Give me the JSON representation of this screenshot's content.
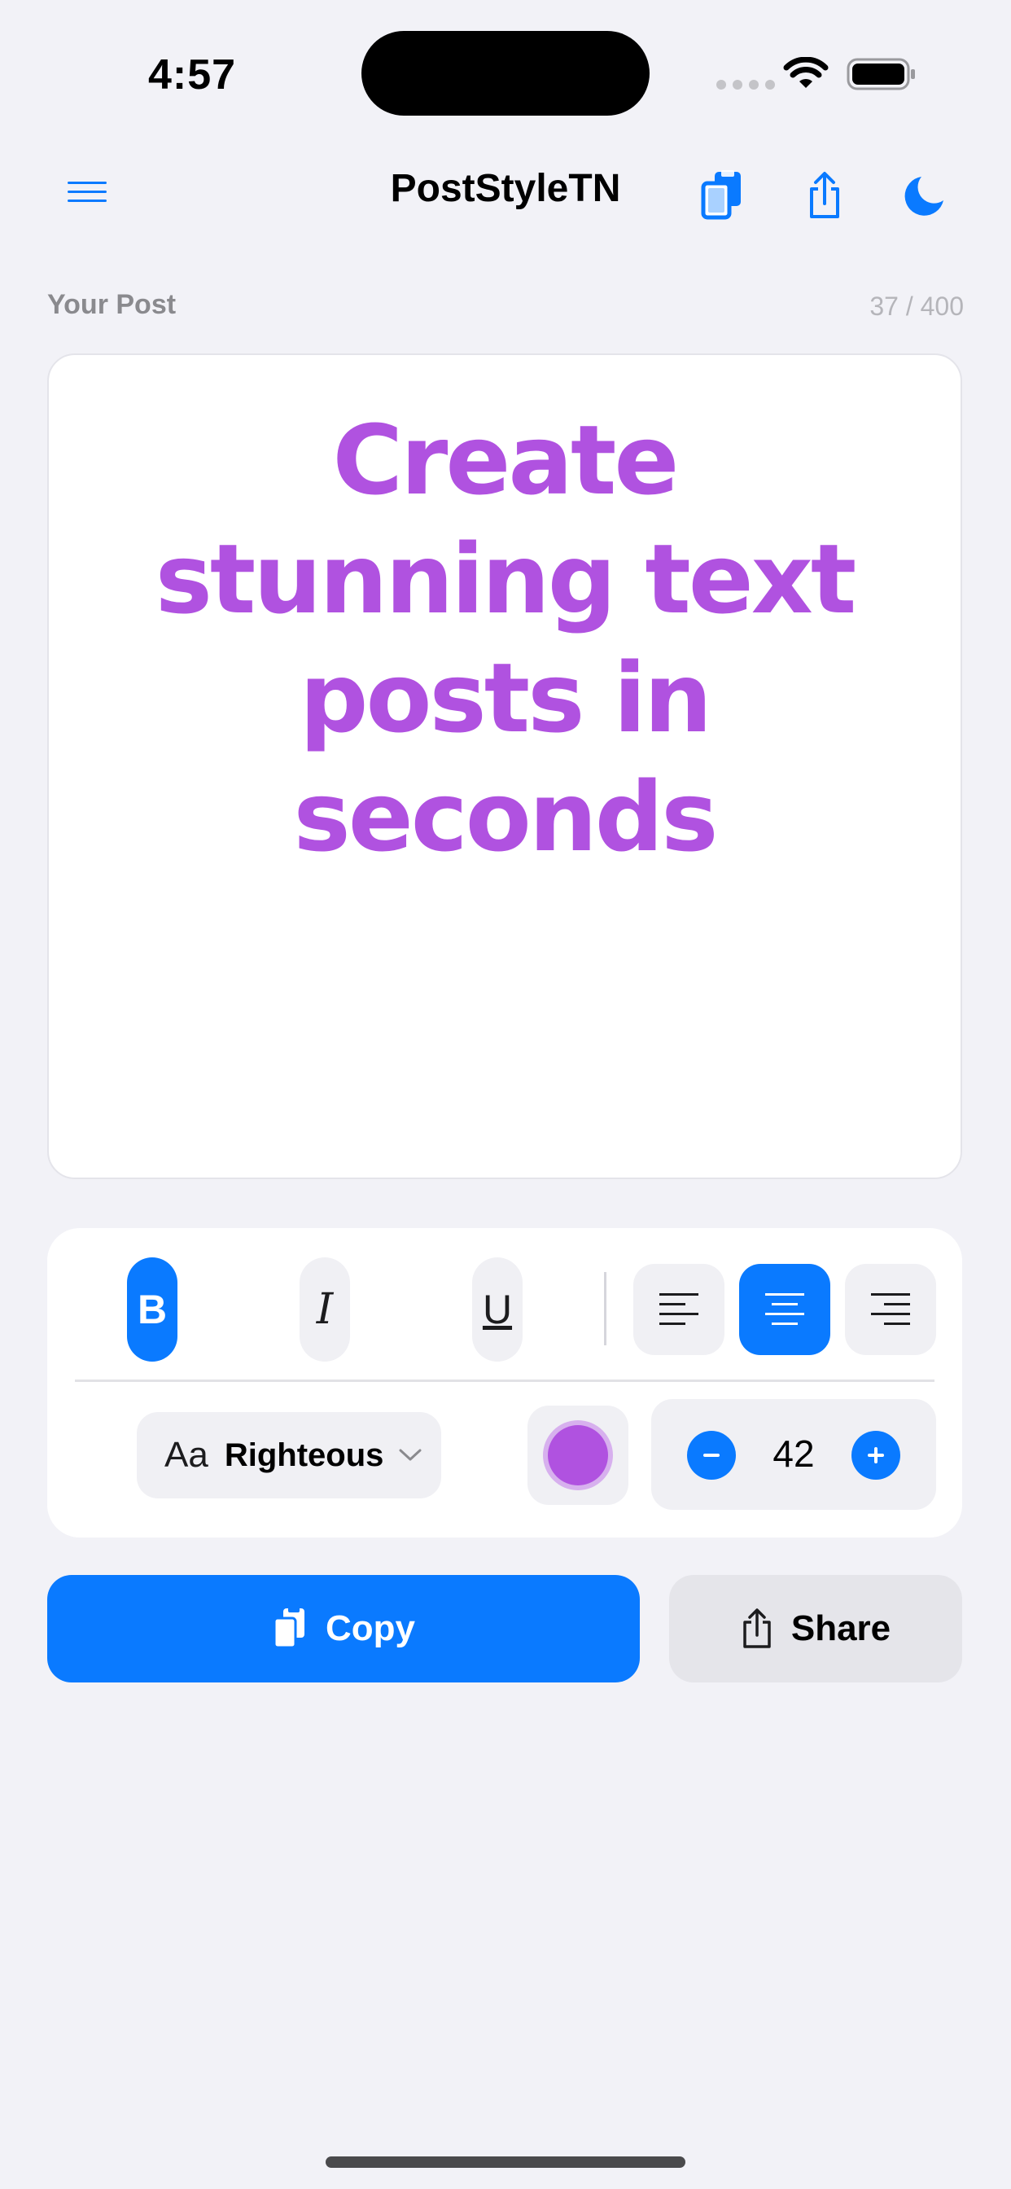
{
  "status_bar": {
    "time": "4:57"
  },
  "nav": {
    "title": "PostStyleTN",
    "icons": [
      "menu-icon",
      "copy-icon",
      "share-icon",
      "moon-icon"
    ]
  },
  "post": {
    "section_label": "Your Post",
    "char_count": "37 / 400",
    "text": "Create stunning text posts in seconds",
    "text_color": "#b052e0"
  },
  "format": {
    "bold_label": "B",
    "italic_label": "I",
    "underline_label": "U",
    "bold_active": true,
    "alignment": "center",
    "font_aa": "Aa",
    "font_name": "Righteous",
    "color": "#b052e0",
    "size": "42"
  },
  "actions": {
    "copy_label": "Copy",
    "share_label": "Share"
  },
  "colors": {
    "accent": "#0a7aff",
    "background": "#f2f2f7"
  }
}
